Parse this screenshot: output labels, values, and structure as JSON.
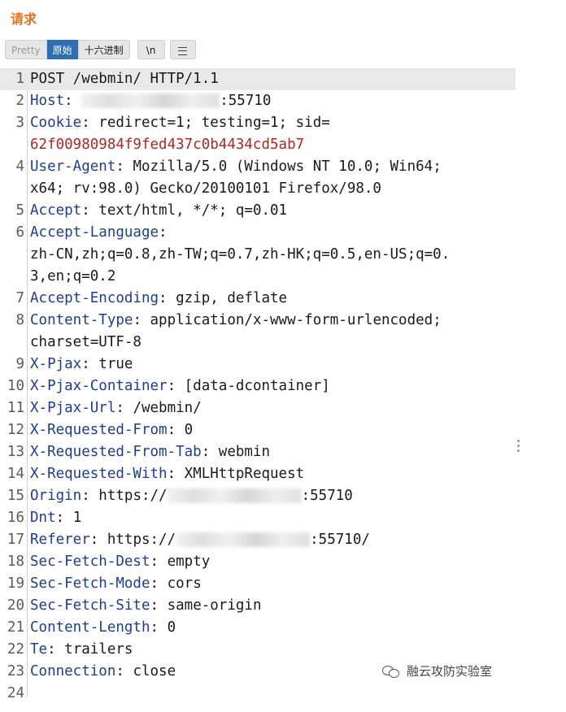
{
  "panel": {
    "title": "请求"
  },
  "toolbar": {
    "pretty": "Pretty",
    "raw": "原始",
    "hex": "十六进制",
    "newline": "\\n"
  },
  "lines": [
    {
      "n": "1",
      "text": "POST /webmin/ HTTP/1.1"
    },
    {
      "n": "2",
      "key": "Host",
      "sep": ": ",
      "after_blur": ":55710"
    },
    {
      "n": "3",
      "key": "Cookie",
      "sep": ": ",
      "value": "redirect=1; testing=1; sid=",
      "cont": "62f00980984f9fed437c0b4434cd5ab7"
    },
    {
      "n": "4",
      "key": "User-Agent",
      "sep": ": ",
      "value": "Mozilla/5.0 (Windows NT 10.0; Win64;",
      "cont": "x64; rv:98.0) Gecko/20100101 Firefox/98.0"
    },
    {
      "n": "5",
      "key": "Accept",
      "sep": ": ",
      "value": "text/html, */*; q=0.01"
    },
    {
      "n": "6",
      "key": "Accept-Language",
      "sep": ":",
      "value": "",
      "cont": "zh-CN,zh;q=0.8,zh-TW;q=0.7,zh-HK;q=0.5,en-US;q=0.",
      "cont2": "3,en;q=0.2"
    },
    {
      "n": "7",
      "key": "Accept-Encoding",
      "sep": ": ",
      "value": "gzip, deflate"
    },
    {
      "n": "8",
      "key": "Content-Type",
      "sep": ": ",
      "value": "application/x-www-form-urlencoded;",
      "cont": "charset=UTF-8"
    },
    {
      "n": "9",
      "key": "X-Pjax",
      "sep": ": ",
      "value": "true"
    },
    {
      "n": "10",
      "key": "X-Pjax-Container",
      "sep": ": ",
      "value": "[data-dcontainer]"
    },
    {
      "n": "11",
      "key": "X-Pjax-Url",
      "sep": ": ",
      "value": "/webmin/"
    },
    {
      "n": "12",
      "key": "X-Requested-From",
      "sep": ": ",
      "value": "0"
    },
    {
      "n": "13",
      "key": "X-Requested-From-Tab",
      "sep": ": ",
      "value": "webmin"
    },
    {
      "n": "14",
      "key": "X-Requested-With",
      "sep": ": ",
      "value": "XMLHttpRequest"
    },
    {
      "n": "15",
      "key": "Origin",
      "sep": ": ",
      "value": "https://",
      "after_blur": ":55710"
    },
    {
      "n": "16",
      "key": "Dnt",
      "sep": ": ",
      "value": "1"
    },
    {
      "n": "17",
      "key": "Referer",
      "sep": ": ",
      "value": "https://",
      "after_blur": ":55710/"
    },
    {
      "n": "18",
      "key": "Sec-Fetch-Dest",
      "sep": ": ",
      "value": "empty"
    },
    {
      "n": "19",
      "key": "Sec-Fetch-Mode",
      "sep": ": ",
      "value": "cors"
    },
    {
      "n": "20",
      "key": "Sec-Fetch-Site",
      "sep": ": ",
      "value": "same-origin"
    },
    {
      "n": "21",
      "key": "Content-Length",
      "sep": ": ",
      "value": "0"
    },
    {
      "n": "22",
      "key": "Te",
      "sep": ": ",
      "value": "trailers"
    },
    {
      "n": "23",
      "key": "Connection",
      "sep": ": ",
      "value": "close"
    },
    {
      "n": "24",
      "text": ""
    }
  ],
  "watermark": {
    "text": "融云攻防实验室"
  },
  "colors": {
    "title": "#e8721c",
    "header_key": "#1a3e97",
    "cookie_value": "#b32620",
    "raw_active": "#2d6fb6"
  }
}
